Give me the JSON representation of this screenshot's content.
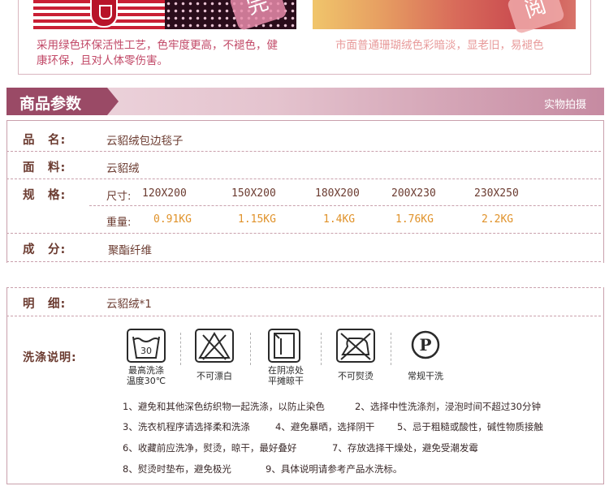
{
  "comparison": {
    "good_stamp": "完",
    "good_caption": "采用绿色环保活性工艺，色牢度更高，不褪色，健康环保，且对人体零伤害。",
    "bad_stamp": "阅",
    "bad_caption": "市面普通珊瑚绒色彩暗淡，显老旧，易褪色"
  },
  "section": {
    "title": "商品参数",
    "note": "实物拍摄"
  },
  "params": {
    "name_label": "品　名:",
    "name_value": "云貂绒包边毯子",
    "fabric_label": "面　料:",
    "fabric_value": "云貂绒",
    "spec_label": "规　格:",
    "size_prefix": "尺寸:",
    "sizes": [
      "120X200",
      "150X200",
      "180X200",
      "200X230",
      "230X250"
    ],
    "weight_prefix": "重量:",
    "weights": [
      "0.91KG",
      "1.15KG",
      "1.4KG",
      "1.76KG",
      "2.2KG"
    ],
    "composition_label": "成　分:",
    "composition_value": "聚酯纤维",
    "detail_label": "明　细:",
    "detail_value": "云貂绒*1",
    "wash_label": "洗涤说明:"
  },
  "wash_icons": [
    {
      "icon": "wash-30-icon",
      "text": "30",
      "label": "最高洗涤\n温度30℃"
    },
    {
      "icon": "no-bleach-icon",
      "label": "不可漂白"
    },
    {
      "icon": "dry-in-shade-icon",
      "label": "在阴凉处\n平摊晾干"
    },
    {
      "icon": "no-iron-icon",
      "label": "不可熨烫"
    },
    {
      "icon": "dry-clean-icon",
      "text": "P",
      "label": "常规干洗"
    }
  ],
  "notes": [
    "1、避免和其他深色纺织物一起洗涤，以防止染色",
    "2、选择中性洗涤剂，浸泡时间不超过30分钟",
    "3、洗衣机程序请选择柔和洗涤",
    "4、避免暴晒，选择阴干",
    "5、忌于粗糙或酸性，碱性物质接触",
    "6、收藏前应洗净，熨烫，晾干，最好叠好",
    "7、存放选择干燥处，避免受潮发霉",
    "8、熨烫时垫布，避免极光",
    "9、具体说明请参考产品水洗标。"
  ],
  "colors": {
    "accent": "#9a4a66",
    "label_brown": "#6b3b30",
    "weight_orange": "#e0922a",
    "good_text": "#c24a68",
    "bad_text": "#e89a9a"
  }
}
